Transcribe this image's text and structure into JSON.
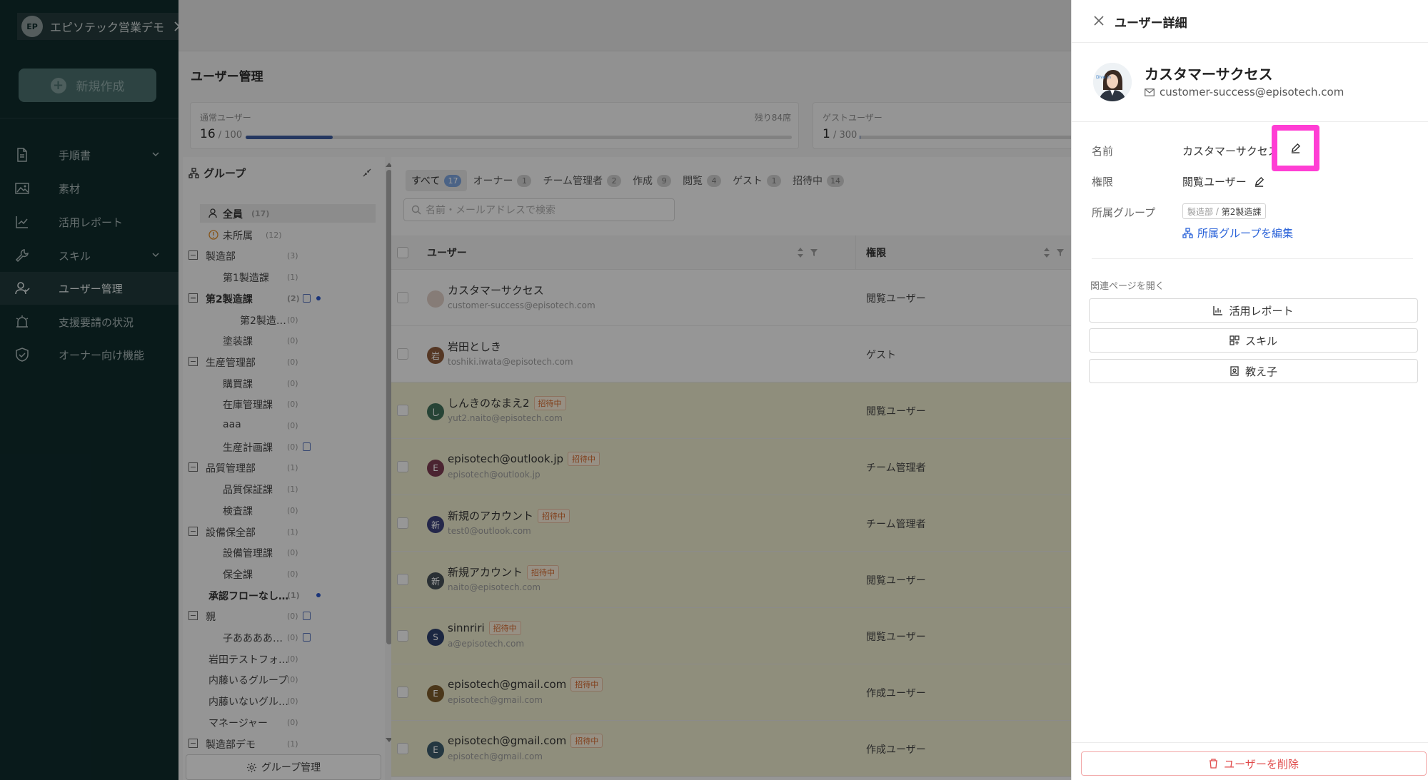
{
  "sidebar": {
    "workspace_name": "エピソテック営業デモ",
    "new_button": "新規作成",
    "items": [
      {
        "label": "手順書",
        "icon": "document-icon"
      },
      {
        "label": "素材",
        "icon": "image-icon"
      },
      {
        "label": "活用レポート",
        "icon": "chart-icon"
      },
      {
        "label": "スキル",
        "icon": "wrench-icon"
      },
      {
        "label": "ユーザー管理",
        "icon": "users-icon"
      },
      {
        "label": "支援要請の状況",
        "icon": "alarm-icon"
      },
      {
        "label": "オーナー向け機能",
        "icon": "shield-icon"
      }
    ]
  },
  "main": {
    "title": "ユーザー管理",
    "stats": {
      "regular": {
        "label": "通常ユーザー",
        "remaining": "残り84席",
        "count": "16",
        "total": " / 100",
        "fill_percent": 16
      },
      "guest": {
        "label": "ゲストユーザー",
        "count": "1",
        "total": " / 300",
        "fill_percent": 0.3
      }
    }
  },
  "groups": {
    "title": "グループ",
    "manage_button": "グループ管理",
    "items": [
      {
        "label": "全員",
        "count": "(17)"
      },
      {
        "label": "未所属",
        "count": "(12)"
      },
      {
        "label": "製造部",
        "count": "(3)"
      },
      {
        "label": "第1製造課",
        "count": "(1)"
      },
      {
        "label": "第2製造課",
        "count": "(2)"
      },
      {
        "label": "第2製造…",
        "count": "(0)"
      },
      {
        "label": "塗装課",
        "count": "(0)"
      },
      {
        "label": "生産管理部",
        "count": "(0)"
      },
      {
        "label": "購買課",
        "count": "(0)"
      },
      {
        "label": "在庫管理課",
        "count": "(0)"
      },
      {
        "label": "aaa",
        "count": "(0)"
      },
      {
        "label": "生産計画課",
        "count": "(0)"
      },
      {
        "label": "品質管理部",
        "count": "(1)"
      },
      {
        "label": "品質保証課",
        "count": "(1)"
      },
      {
        "label": "検査課",
        "count": "(0)"
      },
      {
        "label": "設備保全部",
        "count": "(1)"
      },
      {
        "label": "設備管理課",
        "count": "(0)"
      },
      {
        "label": "保全課",
        "count": "(0)"
      },
      {
        "label": "承認フローなし…",
        "count": "(1)"
      },
      {
        "label": "親",
        "count": "(0)"
      },
      {
        "label": "子ああああ…",
        "count": "(0)"
      },
      {
        "label": "岩田テストフォ…",
        "count": "(0)"
      },
      {
        "label": "内藤いるグループ",
        "count": "(0)"
      },
      {
        "label": "内藤いないグル…",
        "count": "(0)"
      },
      {
        "label": "マネージャー",
        "count": "(0)"
      },
      {
        "label": "製造部デモ",
        "count": "(1)"
      }
    ]
  },
  "user_list": {
    "tabs": [
      {
        "label": "すべて",
        "count": "17"
      },
      {
        "label": "オーナー",
        "count": "1"
      },
      {
        "label": "チーム管理者",
        "count": "2"
      },
      {
        "label": "作成",
        "count": "9"
      },
      {
        "label": "閲覧",
        "count": "4"
      },
      {
        "label": "ゲスト",
        "count": "1"
      },
      {
        "label": "招待中",
        "count": "14"
      }
    ],
    "search_placeholder": "名前・メールアドレスで検索",
    "col_user": "ユーザー",
    "col_role": "権限",
    "invite_tag": "招待中",
    "rows": [
      {
        "name": "カスタマーサクセス",
        "email": "customer-success@episotech.com",
        "role": "閲覧ユーザー",
        "initial": "",
        "color": "#d9c8c0",
        "invited": false
      },
      {
        "name": "岩田としき",
        "email": "toshiki.iwata@episotech.com",
        "role": "ゲスト",
        "initial": "岩",
        "color": "#8a5a3a",
        "invited": false
      },
      {
        "name": "しんきのなまえ2",
        "email": "yut2.naito@episotech.com",
        "role": "閲覧ユーザー",
        "initial": "し",
        "color": "#3f6e57",
        "invited": true
      },
      {
        "name": "episotech@outlook.jp",
        "email": "episotech@outlook.jp",
        "role": "チーム管理者",
        "initial": "E",
        "color": "#7a3a4f",
        "invited": true
      },
      {
        "name": "新規のアカウント",
        "email": "test0@outlook.com",
        "role": "チーム管理者",
        "initial": "新",
        "color": "#3a3f78",
        "invited": true
      },
      {
        "name": "新規アカウント",
        "email": "naito@episotech.com",
        "role": "閲覧ユーザー",
        "initial": "新",
        "color": "#444e55",
        "invited": true
      },
      {
        "name": "sinnriri",
        "email": "a@episotech.com",
        "role": "閲覧ユーザー",
        "initial": "S",
        "color": "#2d3e6a",
        "invited": true
      },
      {
        "name": "episotech@gmail.com",
        "email": "episotech@gmail.com",
        "role": "作成ユーザー",
        "initial": "E",
        "color": "#7a5a2a",
        "invited": true
      },
      {
        "name": "episotech@gmail.com",
        "email": "episotech@gmail.com",
        "role": "作成ユーザー",
        "initial": "E",
        "color": "#3a5a6a",
        "invited": true
      }
    ]
  },
  "drawer": {
    "title": "ユーザー詳細",
    "name": "カスタマーサクセス",
    "email": "customer-success@episotech.com",
    "avatar_text": "Dive in",
    "field_name_label": "名前",
    "field_name_value": "カスタマーサクセス",
    "field_role_label": "権限",
    "field_role_value": "閲覧ユーザー",
    "field_group_label": "所属グループ",
    "group_parent": "製造部",
    "group_child": "第2製造課",
    "edit_group_link": "所属グループを編集",
    "related_label": "関連ページを開く",
    "related_buttons": [
      "活用レポート",
      "スキル",
      "教え子"
    ],
    "delete_button": "ユーザーを削除",
    "highlight_color": "#ff3ed4"
  }
}
